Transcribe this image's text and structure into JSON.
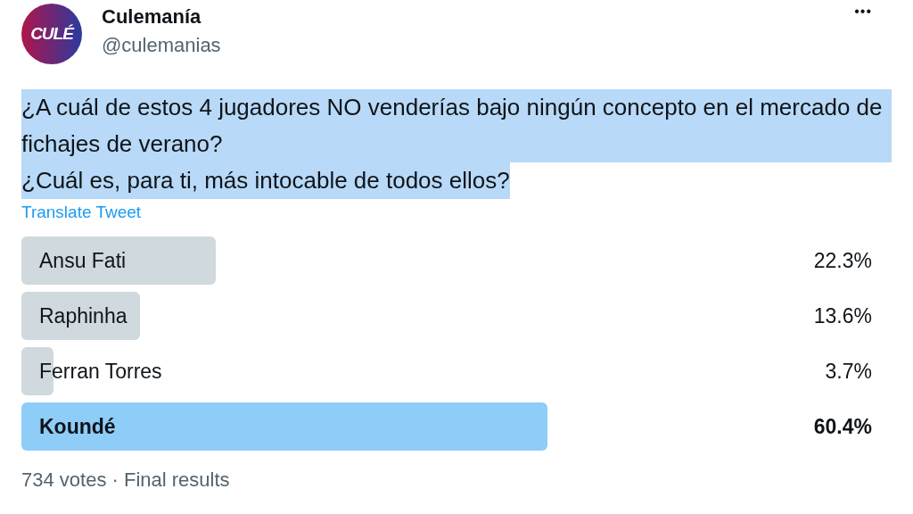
{
  "author": {
    "avatar_text": "CULÉ",
    "name": "Culemanía",
    "handle": "@culemanias"
  },
  "more": "•••",
  "tweet": {
    "highlighted": true,
    "lines": [
      "¿A cuál de estos 4 jugadores NO venderías bajo ningún concepto en el mercado de fichajes de verano?",
      "¿Cuál es, para ti, más intocable de todos ellos?"
    ]
  },
  "translate": "Translate Tweet",
  "poll": {
    "options": [
      {
        "label": "Ansu Fati",
        "percent": "22.3%",
        "level": 0.223,
        "selected": false
      },
      {
        "label": "Raphinha",
        "percent": "13.6%",
        "level": 0.136,
        "selected": false
      },
      {
        "label": "Ferran Torres",
        "percent": "3.7%",
        "level": 0.037,
        "selected": false
      },
      {
        "label": "Koundé",
        "percent": "60.4%",
        "level": 0.604,
        "selected": true
      }
    ],
    "summary": "734 votes · Final results"
  }
}
